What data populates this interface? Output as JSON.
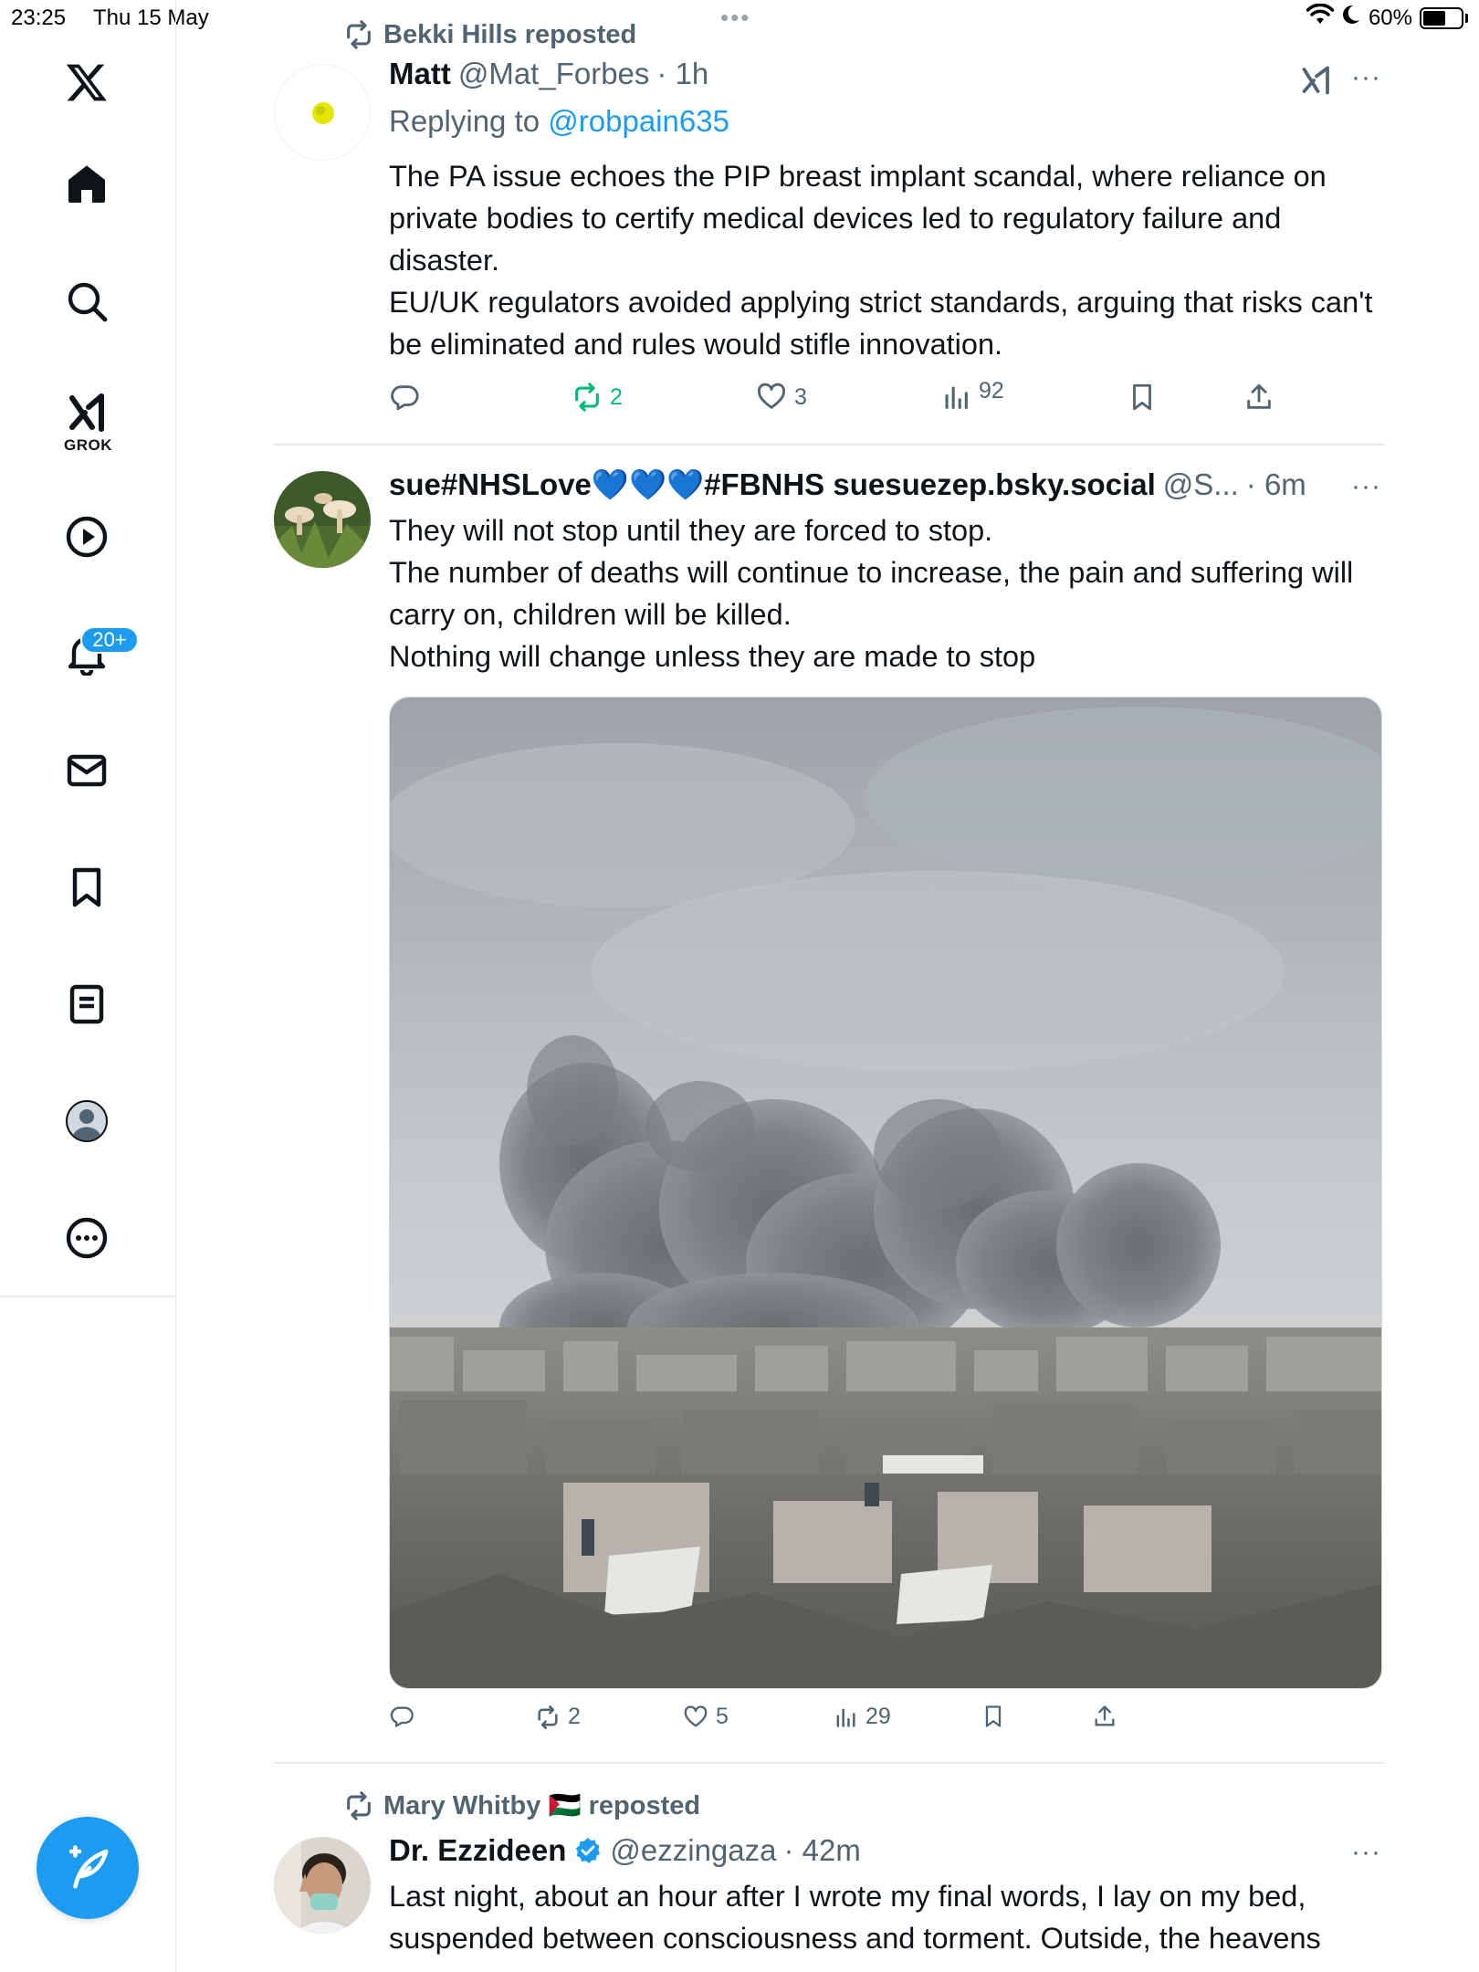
{
  "status_bar": {
    "time": "23:25",
    "date": "Thu 15 May",
    "battery": "60%",
    "battery_level": 0.6
  },
  "sidebar": {
    "items": [
      {
        "name": "x-logo-icon"
      },
      {
        "name": "home-icon"
      },
      {
        "name": "search-icon"
      },
      {
        "name": "grok-icon",
        "label": "GROK"
      },
      {
        "name": "video-icon"
      },
      {
        "name": "notifications-icon",
        "badge": "20+"
      },
      {
        "name": "messages-icon"
      },
      {
        "name": "bookmarks-icon"
      },
      {
        "name": "lists-icon"
      },
      {
        "name": "profile-icon"
      },
      {
        "name": "more-icon"
      }
    ],
    "compose_icon": "compose-icon"
  },
  "tweets": [
    {
      "reposted_by": "Bekki Hills reposted",
      "name": "Matt",
      "handle": "@Mat_Forbes",
      "time": "· 1h",
      "reply_prefix": "Replying to",
      "reply_handle": "@robpain635",
      "text": [
        "The PA issue echoes the PIP breast implant scandal, where reliance on private bodies to certify medical devices led to regulatory failure and disaster.",
        "EU/UK regulators avoided applying strict standards, arguing  that risks can't be eliminated and rules would stifle innovation."
      ],
      "more": "···",
      "stats": {
        "replies": "",
        "reposts": "2",
        "likes": "3",
        "views": "92"
      },
      "accent": "#00ba7c"
    },
    {
      "name": "sue#NHSLove💙💙💙#FBNHS suesuezep.bsky.social",
      "handle": "@S...",
      "time": "· 6m",
      "text": [
        "They will not stop until they are forced to stop.",
        "The number of deaths will continue to increase, the pain and suffering will carry on, children will be killed.",
        "Nothing will change unless they are made to stop"
      ],
      "more": "···",
      "stats": {
        "replies": "",
        "reposts": "2",
        "likes": "5",
        "views": "29"
      }
    },
    {
      "reposted_by": "Mary Whitby 🇵🇸 reposted",
      "name": "Dr. Ezzideen",
      "handle": "@ezzingaza",
      "time": "· 42m",
      "text": [
        "Last night, about an hour after I wrote my final words, I lay on my bed, suspended between consciousness and torment. Outside, the heavens"
      ],
      "more": "···"
    }
  ],
  "colors": {
    "brand_blue": "#1d9bf0",
    "text_primary": "#0f1419",
    "text_secondary": "#536471",
    "repost_green": "#00ba7c"
  }
}
